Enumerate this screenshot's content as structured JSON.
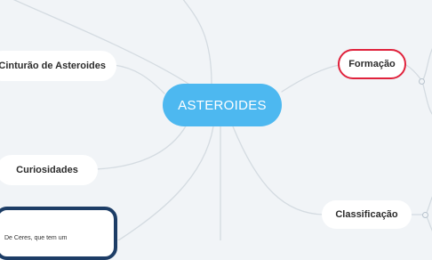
{
  "central_topic": "ASTEROIDES",
  "branches": {
    "cinturao": "Cinturão de Asteroides",
    "curiosidades": "Curiosidades",
    "formacao": "Formação",
    "classificacao": "Classificação"
  },
  "note": {
    "text": "De Ceres, que tem um"
  },
  "colors": {
    "background": "#f1f4f7",
    "central": "#4db8f0",
    "formacao_border": "#e0223c",
    "note_border": "#1d3d66",
    "connector": "#d4dbe1"
  }
}
